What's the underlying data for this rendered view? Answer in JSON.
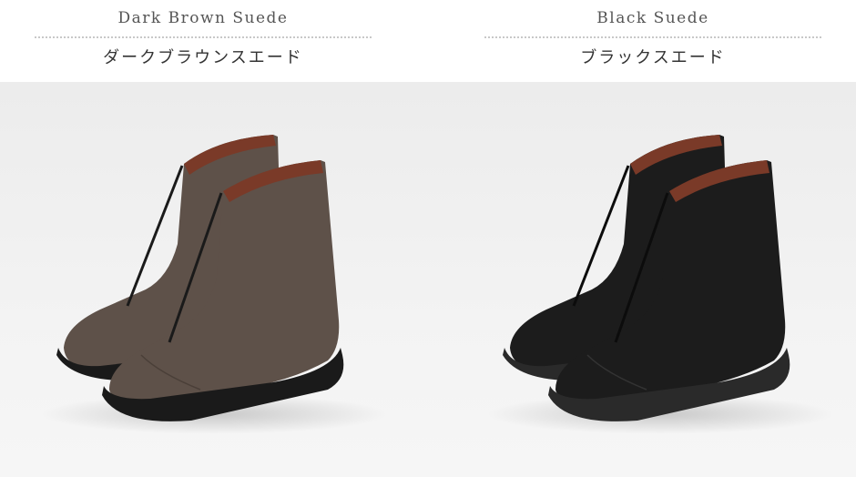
{
  "products": [
    {
      "name_en": "Dark Brown Suede",
      "name_jp": "ダークブラウンスエード",
      "color": "#5e5149"
    },
    {
      "name_en": "Black Suede",
      "name_jp": "ブラックスエード",
      "color": "#1c1c1c"
    }
  ],
  "colors": {
    "background": "#f2f2f2",
    "divider": "#c8c8c8",
    "heading_text": "#555555",
    "lining": "#7a3a28",
    "sole": "#1a1a1a"
  }
}
